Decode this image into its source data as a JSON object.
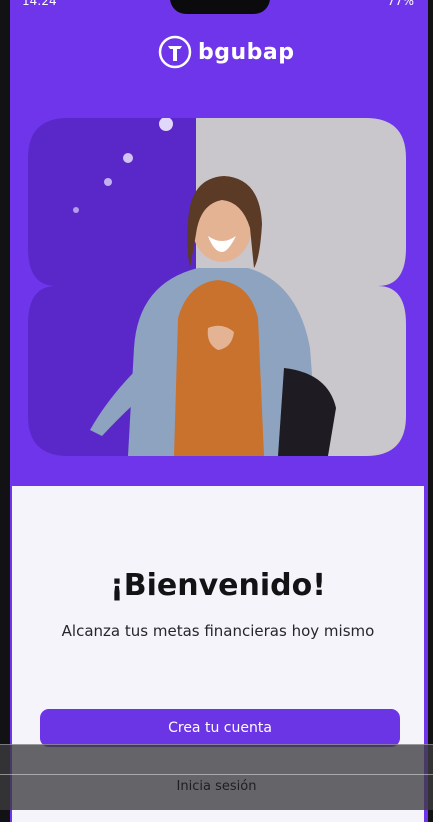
{
  "status_bar": {
    "time": "14:24",
    "indicators": "77%"
  },
  "brand": {
    "name": "bgubap",
    "icon": "bank-pillar-logo-icon"
  },
  "colors": {
    "brand_purple": "#6f35ea",
    "button_purple": "#6b34e4",
    "panel_background": "#f6f4fb"
  },
  "hero": {
    "image": "smiling-woman-denim-jacket-photo"
  },
  "welcome": {
    "title": "¡Bienvenido!",
    "subtitle": "Alcanza tus metas financieras hoy mismo"
  },
  "actions": {
    "create_account": "Crea tu cuenta",
    "sign_in": "Inicia sesión"
  }
}
